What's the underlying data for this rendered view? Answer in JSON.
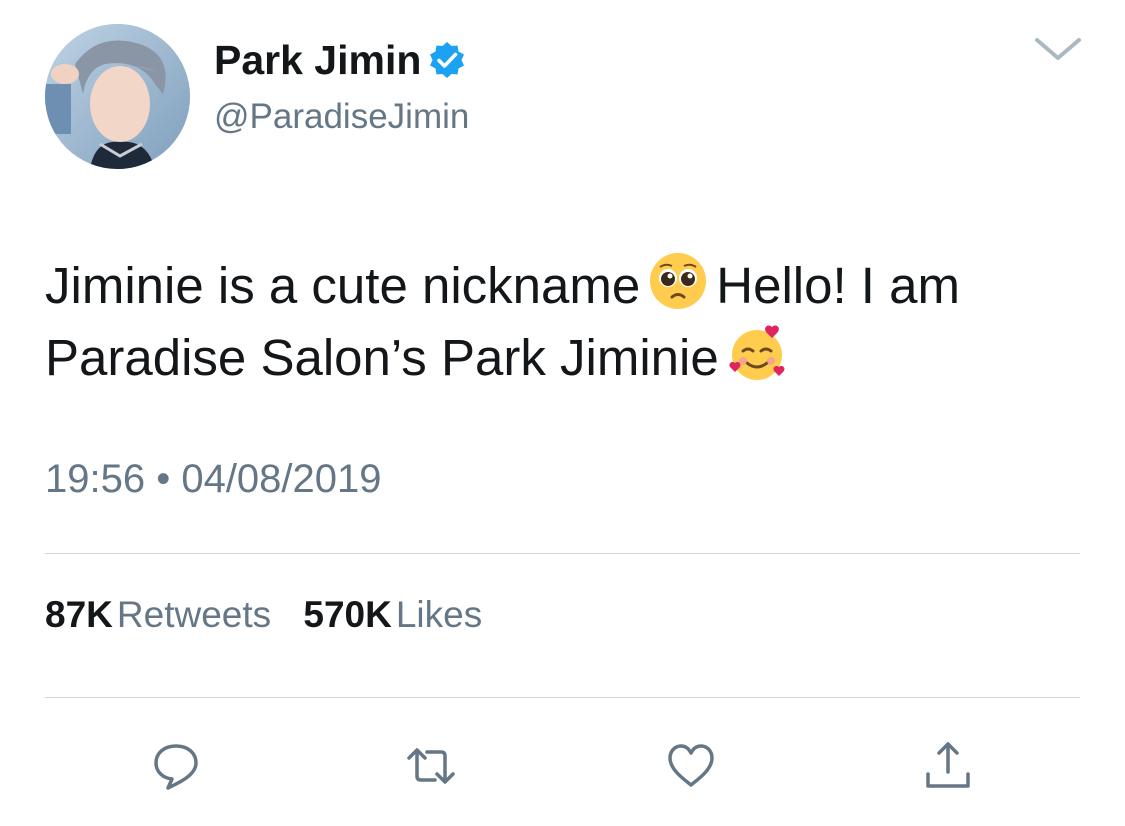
{
  "user": {
    "display_name": "Park Jimin",
    "handle": "@ParadiseJimin",
    "verified": true
  },
  "tweet": {
    "text_part1": "Jiminie is a cute nickname",
    "emoji1": "pleading-face",
    "text_part2": "Hello! I am Paradise Salon’s Park Jiminie",
    "emoji2": "smiling-face-with-hearts",
    "timestamp": "19:56 • 04/08/2019"
  },
  "stats": {
    "retweets_count": "87K",
    "retweets_label": "Retweets",
    "likes_count": "570K",
    "likes_label": "Likes"
  },
  "actions": {
    "reply_icon": "reply-icon",
    "retweet_icon": "retweet-icon",
    "like_icon": "heart-icon",
    "share_icon": "share-icon"
  },
  "colors": {
    "primary_text": "#14171a",
    "secondary_text": "#657786",
    "divider": "#ccd6dd",
    "verified_blue": "#1da1f2"
  }
}
